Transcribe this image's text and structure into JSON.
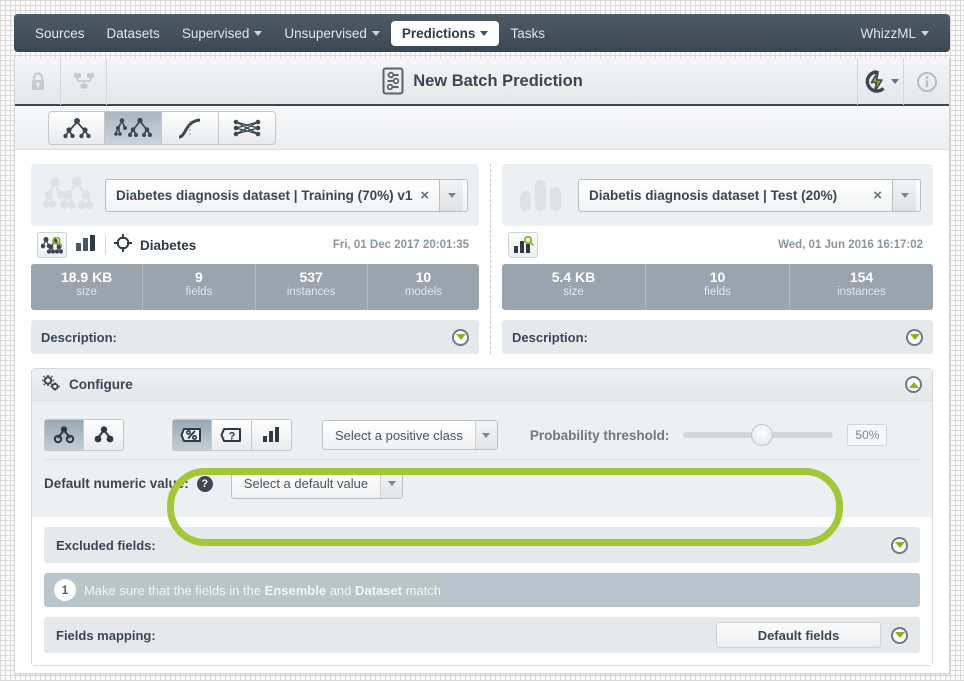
{
  "navbar": {
    "items": [
      {
        "label": "Sources",
        "caret": false,
        "active": false
      },
      {
        "label": "Datasets",
        "caret": false,
        "active": false
      },
      {
        "label": "Supervised",
        "caret": true,
        "active": false
      },
      {
        "label": "Unsupervised",
        "caret": true,
        "active": false
      },
      {
        "label": "Predictions",
        "caret": true,
        "active": true
      },
      {
        "label": "Tasks",
        "caret": false,
        "active": false
      }
    ],
    "right": {
      "label": "WhizzML",
      "caret": true
    }
  },
  "titlebar": {
    "title": "New Batch Prediction",
    "lock_icon": "lock-icon",
    "share_icon": "share-network-icon",
    "title_icon": "batch-prediction-icon",
    "action_icon": "lightning-bolt-icon",
    "info_icon": "info-icon"
  },
  "type_tabs": [
    {
      "name": "model-tab",
      "icon": "decision-tree-icon",
      "active": false
    },
    {
      "name": "ensemble-tab",
      "icon": "ensemble-icon",
      "active": true
    },
    {
      "name": "logistic-regression-tab",
      "icon": "logistic-curve-icon",
      "active": false
    },
    {
      "name": "deepnet-tab",
      "icon": "deepnet-icon",
      "active": false
    }
  ],
  "left_panel": {
    "selector": {
      "icon": "ensemble-icon",
      "value": "Diabetes diagnosis dataset | Training (70%) v1",
      "clear": "×"
    },
    "resource": {
      "type_icon": "ensemble-search-icon",
      "chart_icon": "bars-icon",
      "objective_icon": "target-icon",
      "name": "Diabetes",
      "date": "Fri, 01 Dec 2017 20:01:35"
    },
    "stats": [
      {
        "value": "18.9 KB",
        "label": "size"
      },
      {
        "value": "9",
        "label": "fields"
      },
      {
        "value": "537",
        "label": "instances"
      },
      {
        "value": "10",
        "label": "models"
      }
    ],
    "description_label": "Description:"
  },
  "right_panel": {
    "selector": {
      "icon": "dataset-bars-icon",
      "value": "Diabetis diagnosis dataset | Test (20%)",
      "clear": "×"
    },
    "resource": {
      "type_icon": "dataset-search-icon",
      "date": "Wed, 01 Jun 2016 16:17:02"
    },
    "stats": [
      {
        "value": "5.4 KB",
        "label": "size"
      },
      {
        "value": "10",
        "label": "fields"
      },
      {
        "value": "154",
        "label": "instances"
      }
    ],
    "description_label": "Description:"
  },
  "configure": {
    "header": "Configure",
    "header_icon": "gears-icon",
    "collapse_icon": "chevron-up-circle-icon",
    "model_toggle": [
      {
        "name": "single-model-toggle",
        "icon": "model-node-icon",
        "active": true
      },
      {
        "name": "all-models-toggle",
        "icon": "model-node-filled-icon",
        "active": false
      }
    ],
    "output_toggle": [
      {
        "name": "probability-output-toggle",
        "icon": "percent-tag-icon",
        "active": true
      },
      {
        "name": "confidence-output-toggle",
        "icon": "question-tag-icon",
        "active": false
      },
      {
        "name": "distribution-output-toggle",
        "icon": "bars-icon",
        "active": false
      }
    ],
    "positive_class": {
      "label": "Select a positive class",
      "name": "positive-class-select"
    },
    "probability_threshold": {
      "label": "Probability threshold:",
      "value": "50%",
      "percent": 50
    },
    "default_numeric": {
      "label": "Default numeric value:",
      "help_icon": "question-help-icon",
      "select_label": "Select a default value"
    },
    "excluded_fields": {
      "label": "Excluded fields:",
      "expand_icon": "chevron-down-circle-icon"
    },
    "note": {
      "number": "1",
      "prefix": "Make sure that the fields in the ",
      "bold1": "Ensemble",
      "middle": " and ",
      "bold2": "Dataset",
      "suffix": " match"
    },
    "fields_mapping": {
      "label": "Fields mapping:",
      "button": "Default fields",
      "expand_icon": "chevron-down-circle-icon"
    }
  },
  "colors": {
    "navbar": "#3c4752",
    "accent_green": "#a4c639",
    "stat_bar": "#9aa4ac",
    "panel_bg": "#edf0f2"
  }
}
